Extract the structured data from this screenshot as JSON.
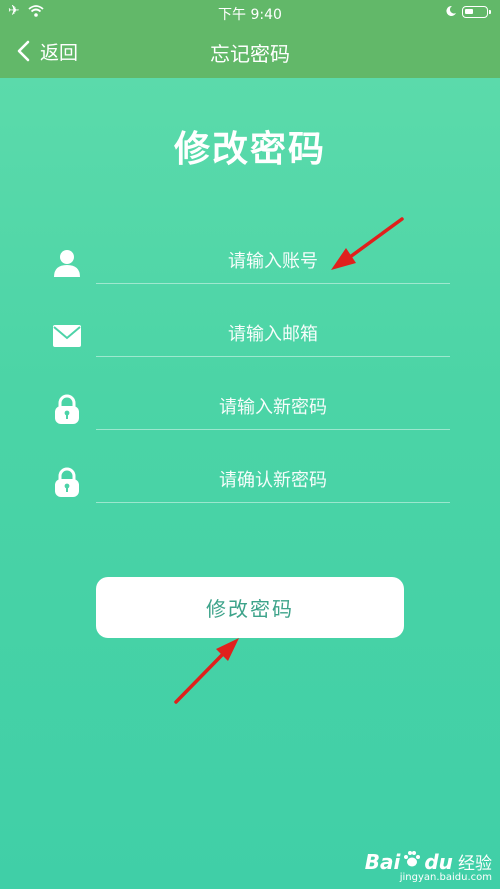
{
  "status_bar": {
    "time": "下午 9:40",
    "icons": [
      "airplane-icon",
      "wifi-icon",
      "moon-icon",
      "battery-icon"
    ],
    "battery_level": 0.4
  },
  "nav": {
    "back_label": "返回",
    "title": "忘记密码"
  },
  "page": {
    "title": "修改密码"
  },
  "form": {
    "fields": [
      {
        "icon": "user-icon",
        "placeholder": "请输入账号",
        "value": ""
      },
      {
        "icon": "mail-icon",
        "placeholder": "请输入邮箱",
        "value": ""
      },
      {
        "icon": "lock-icon",
        "placeholder": "请输入新密码",
        "value": ""
      },
      {
        "icon": "lock-icon",
        "placeholder": "请确认新密码",
        "value": ""
      }
    ],
    "submit_label": "修改密码"
  },
  "watermark": {
    "brand": "Bai",
    "brand_suffix": "du",
    "product": "经验",
    "url": "jingyan.baidu.com"
  },
  "colors": {
    "nav_bar": "#62b869",
    "background_top": "#5fdcac",
    "background_bottom": "#40cfa7",
    "button_text": "#3da38a",
    "annotation_arrow": "#e0201c"
  }
}
